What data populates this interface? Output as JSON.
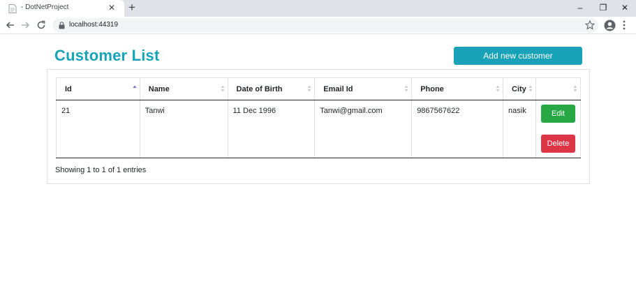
{
  "browser": {
    "tab_title": "- DotNetProject",
    "tab_close": "✕",
    "new_tab": "+",
    "url": "localhost:44319",
    "win_minimize": "–",
    "win_restore": "❐",
    "win_close": "✕"
  },
  "page": {
    "title": "Customer List",
    "add_button": "Add new customer"
  },
  "table": {
    "columns": [
      "Id",
      "Name",
      "Date of Birth",
      "Email Id",
      "Phone",
      "City",
      ""
    ],
    "sorted_column": "Id",
    "sort_direction": "asc",
    "rows": [
      {
        "id": "21",
        "name": "Tanwi",
        "dob": "11 Dec 1996",
        "email": "Tanwi@gmail.com",
        "phone": "9867567622",
        "city": "nasik",
        "edit_label": "Edit",
        "delete_label": "Delete"
      }
    ],
    "info": "Showing 1 to 1 of 1 entries"
  },
  "colors": {
    "accent": "#17a2b8",
    "edit": "#28a745",
    "delete": "#dc3545",
    "sort_active": "#7b68c9"
  }
}
